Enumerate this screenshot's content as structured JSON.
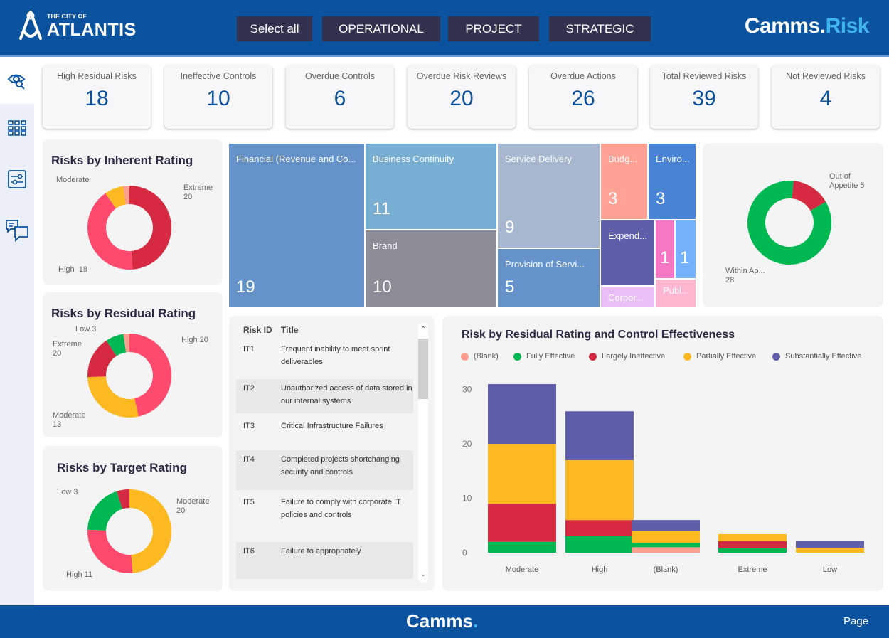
{
  "header": {
    "logo_small": "THE CITY OF",
    "logo_big": "ATLANTIS",
    "filters": [
      "Select all",
      "OPERATIONAL",
      "PROJECT",
      "STRATEGIC"
    ],
    "brand_main": "Camms.",
    "brand_accent": "Risk"
  },
  "sidebar": {
    "items": [
      {
        "icon": "eye-search-icon"
      },
      {
        "icon": "grid-icon"
      },
      {
        "icon": "sliders-icon"
      },
      {
        "icon": "chat-icon"
      }
    ]
  },
  "kpis": [
    {
      "label": "High Residual Risks",
      "value": "18"
    },
    {
      "label": "Ineffective Controls",
      "value": "10"
    },
    {
      "label": "Overdue Controls",
      "value": "6"
    },
    {
      "label": "Overdue Risk Reviews",
      "value": "20"
    },
    {
      "label": "Overdue Actions",
      "value": "26"
    },
    {
      "label": "Total Reviewed Risks",
      "value": "39"
    },
    {
      "label": "Not Reviewed Risks",
      "value": "4"
    }
  ],
  "donuts": {
    "inherent": {
      "title": "Risks by Inherent Rating",
      "labels": [
        "Moderate",
        "Extreme\n20",
        "High  18"
      ],
      "slices": [
        {
          "name": "Extreme",
          "value": 20,
          "color": "#d62a42"
        },
        {
          "name": "High",
          "value": 17,
          "color": "#ff4a6e"
        },
        {
          "name": "Moderate",
          "value": 3,
          "color": "#fdb921"
        },
        {
          "name": "(Blank)",
          "value": 1,
          "color": "#ff9d8f"
        }
      ]
    },
    "residual": {
      "title": "Risks by Residual Rating",
      "labels": [
        "Low 3",
        "High  20",
        "Extreme\n20",
        "Moderate\n13"
      ],
      "slices": [
        {
          "name": "High",
          "value": 20,
          "color": "#ff4a6e"
        },
        {
          "name": "Moderate",
          "value": 12,
          "color": "#fdb921"
        },
        {
          "name": "Extreme",
          "value": 7,
          "color": "#d62a42"
        },
        {
          "name": "Low",
          "value": 3,
          "color": "#00b852"
        },
        {
          "name": "(Blank)",
          "value": 1,
          "color": "#ff9d8f"
        }
      ]
    },
    "target": {
      "title": "Risks by Target Rating",
      "labels": [
        "Low 3",
        "Moderate\n20",
        "High 11"
      ],
      "slices": [
        {
          "name": "Moderate",
          "value": 20,
          "color": "#fdb921"
        },
        {
          "name": "High",
          "value": 11,
          "color": "#ff4a6e"
        },
        {
          "name": "Low",
          "value": 8,
          "color": "#00b852"
        },
        {
          "name": "Extreme",
          "value": 2,
          "color": "#d62a42"
        }
      ]
    },
    "appetite": {
      "labels": [
        "Out of\nAppetite 5",
        "Within Ap...\n28"
      ],
      "slices": [
        {
          "name": "Out of Appetite",
          "value": 5,
          "color": "#d62a42"
        },
        {
          "name": "Within Appetite",
          "value": 28,
          "color": "#00b852"
        }
      ]
    }
  },
  "treemap": [
    {
      "label": "Financial (Revenue and Co...",
      "value": "19",
      "color": "#6592c8"
    },
    {
      "label": "Business Continuity",
      "value": "11",
      "color": "#79aed3"
    },
    {
      "label": "Brand",
      "value": "10",
      "color": "#8c8c96"
    },
    {
      "label": "Service Delivery",
      "value": "9",
      "color": "#a7b7cf"
    },
    {
      "label": "Provision of Servi...",
      "value": "5",
      "color": "#6592c8"
    },
    {
      "label": "Budg...",
      "value": "3",
      "color": "#ffa194"
    },
    {
      "label": "Enviro...",
      "value": "3",
      "color": "#4883d5"
    },
    {
      "label": "Expend...",
      "value": "",
      "color": "#5f5eaa"
    },
    {
      "label": "Corpor...",
      "value": "",
      "color": "#e9bdf5"
    },
    {
      "label": "",
      "value": "1",
      "color": "#f576c2"
    },
    {
      "label": "",
      "value": "1",
      "color": "#74b2fb"
    },
    {
      "label": "Publ...",
      "value": "",
      "color": "#ffb6d0"
    }
  ],
  "table": {
    "headers": [
      "Risk ID",
      "Title"
    ],
    "rows": [
      {
        "id": "IT1",
        "title": "Frequent inability to meet sprint deliverables"
      },
      {
        "id": "IT2",
        "title": "Unauthorized access of data stored in our internal systems"
      },
      {
        "id": "IT3",
        "title": "Critical Infrastructure Failures"
      },
      {
        "id": "IT4",
        "title": "Completed projects shortchanging security and controls"
      },
      {
        "id": "IT5",
        "title": "Failure to comply with corporate IT policies and controls"
      },
      {
        "id": "IT6",
        "title": "Failure to appropriately"
      }
    ]
  },
  "chart_data": {
    "type": "bar",
    "stacked": true,
    "title": "Risk by Residual Rating and Control Effectiveness",
    "categories": [
      "Moderate",
      "High",
      "(Blank)",
      "Extreme",
      "Low"
    ],
    "yticks": [
      0,
      10,
      20,
      30
    ],
    "ylim": [
      0,
      32
    ],
    "legend": "top-left",
    "series": [
      {
        "name": "(Blank)",
        "color": "#ff9d8f",
        "values": [
          0,
          0,
          1,
          0,
          0
        ]
      },
      {
        "name": "Fully Effective",
        "color": "#00b852",
        "values": [
          2,
          3,
          0.8,
          0.8,
          0
        ]
      },
      {
        "name": "Largely Ineffective",
        "color": "#d62a42",
        "values": [
          7,
          3,
          0,
          1.3,
          0
        ]
      },
      {
        "name": "Partially Effective",
        "color": "#fdb921",
        "values": [
          11,
          11,
          2.2,
          1.3,
          0.9
        ]
      },
      {
        "name": "Substantially Effective",
        "color": "#5f5eaa",
        "values": [
          11,
          9,
          2,
          0,
          1.3
        ]
      }
    ]
  },
  "footer": {
    "brand": "Camms",
    "page": "Page"
  }
}
